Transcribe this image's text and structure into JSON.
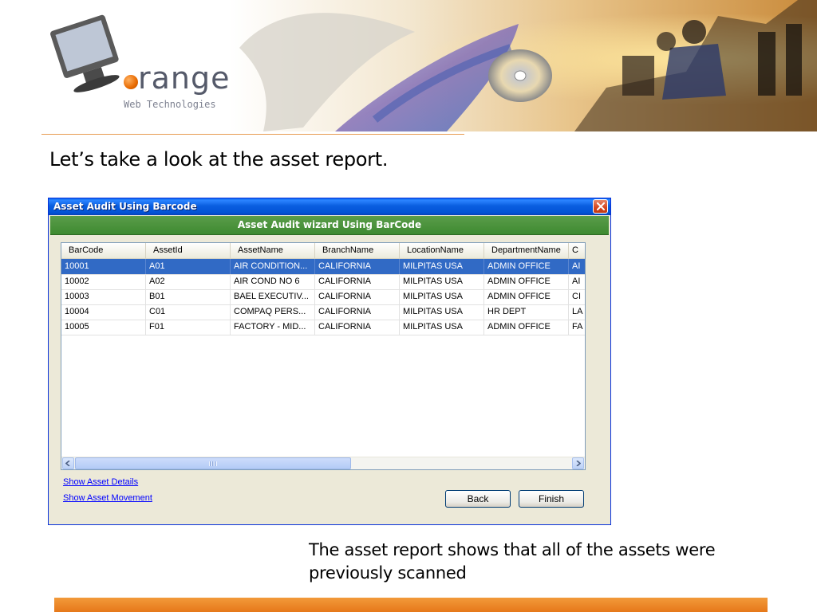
{
  "logo": {
    "brand": "range",
    "tagline": "Web Technologies"
  },
  "slide": {
    "title": "Let’s take a look at the asset report.",
    "caption": "The asset report shows that all of the assets were previously scanned"
  },
  "window": {
    "title": "Asset Audit Using Barcode",
    "banner": "Asset Audit wizard Using BarCode",
    "columns": [
      "BarCode",
      "AssetId",
      "AssetName",
      "BranchName",
      "LocationName",
      "DepartmentName",
      "C"
    ],
    "rows": [
      [
        "10001",
        "A01",
        "AIR CONDITION...",
        "CALIFORNIA",
        "MILPITAS USA",
        "ADMIN OFFICE",
        "AI"
      ],
      [
        "10002",
        "A02",
        "AIR COND NO 6",
        "CALIFORNIA",
        "MILPITAS USA",
        "ADMIN OFFICE",
        "AI"
      ],
      [
        "10003",
        "B01",
        "BAEL EXECUTIV...",
        "CALIFORNIA",
        "MILPITAS USA",
        "ADMIN OFFICE",
        "CI"
      ],
      [
        "10004",
        "C01",
        "COMPAQ PERS...",
        "CALIFORNIA",
        "MILPITAS USA",
        "HR DEPT",
        "LA"
      ],
      [
        "10005",
        "F01",
        "FACTORY - MID...",
        "CALIFORNIA",
        "MILPITAS USA",
        "ADMIN OFFICE",
        "FA"
      ]
    ],
    "selected_row_index": 0,
    "links": {
      "details": "Show Asset Details",
      "movement": "Show Asset Movement"
    },
    "buttons": {
      "back": "Back",
      "finish": "Finish"
    }
  },
  "colors": {
    "titlebar": "#0a5ee0",
    "banner_green": "#3e8a30",
    "selection": "#316ac5",
    "accent_orange": "#e6781a"
  }
}
